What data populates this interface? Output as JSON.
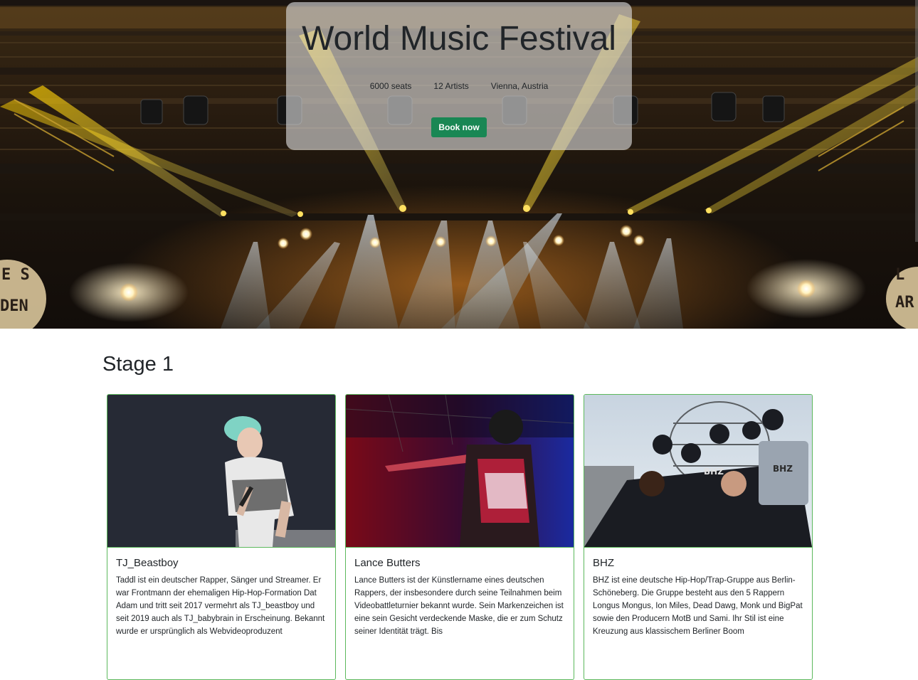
{
  "hero": {
    "title": "World Music Festival",
    "facts": [
      "6000 seats",
      "12 Artists",
      "Vienna, Austria"
    ],
    "book_label": "Book now",
    "book_color": "#198754"
  },
  "stage": {
    "title": "Stage 1",
    "accent_color": "#5cb85c",
    "artists": [
      {
        "name": "TJ_Beastboy",
        "description": "Taddl ist ein deutscher Rapper, Sänger und Streamer. Er war Frontmann der ehemaligen Hip-Hop-Formation Dat Adam und tritt seit 2017 vermehrt als TJ_beastboy und seit 2019 auch als TJ_babybrain in Erscheinung. Bekannt wurde er ursprünglich als Webvideoproduzent"
      },
      {
        "name": "Lance Butters",
        "description": "Lance Butters ist der Künstlername eines deutschen Rappers, der insbesondere durch seine Teilnahmen beim Videobattleturnier bekannt wurde. Sein Markenzeichen ist eine sein Gesicht verdeckende Maske, die er zum Schutz seiner Identität trägt. Bis"
      },
      {
        "name": "BHZ",
        "description": "BHZ ist eine deutsche Hip-Hop/Trap-Gruppe aus Berlin-Schöneberg. Die Gruppe besteht aus den 5 Rappern Longus Mongus, Ion Miles, Dead Dawg, Monk und BigPat sowie den Producern MotB und Sami. Ihr Stil ist eine Kreuzung aus klassischem Berliner Boom"
      }
    ]
  }
}
